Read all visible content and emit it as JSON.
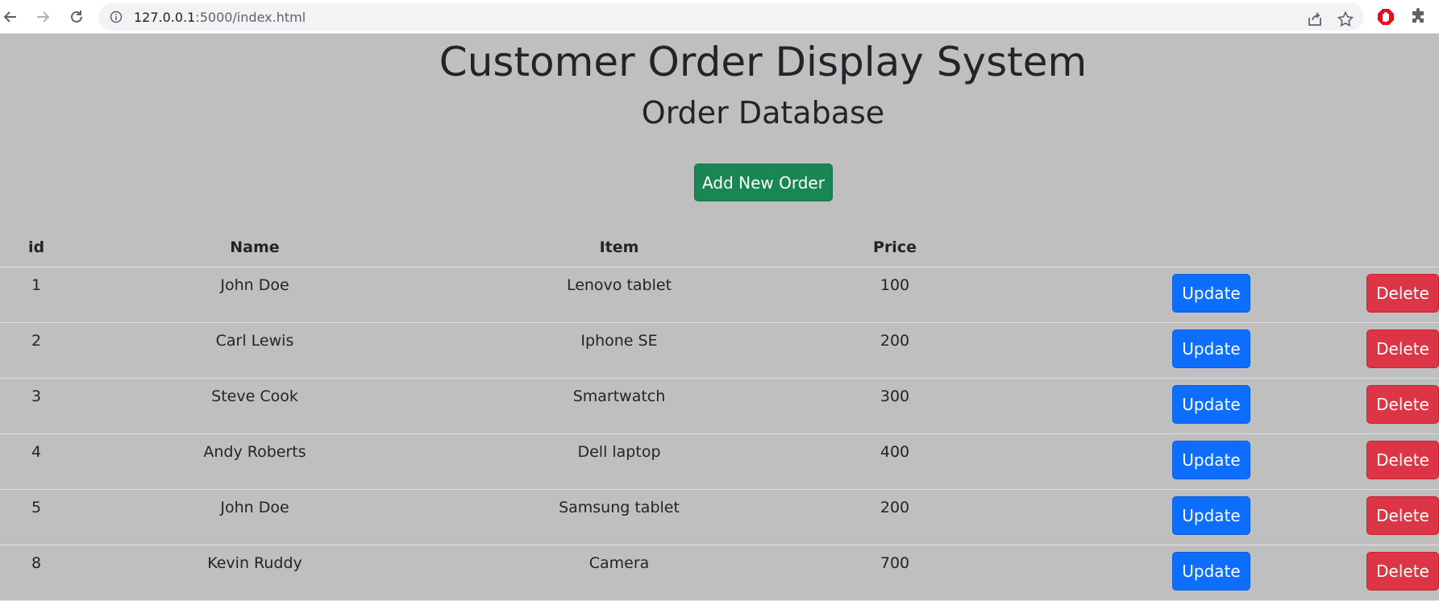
{
  "browser": {
    "url_host": "127.0.0.1",
    "url_rest": ":5000/index.html"
  },
  "page": {
    "title": "Customer Order Display System",
    "subtitle": "Order Database",
    "add_button_label": "Add New Order"
  },
  "table": {
    "headers": {
      "id": "id",
      "name": "Name",
      "item": "Item",
      "price": "Price"
    },
    "update_label": "Update",
    "delete_label": "Delete",
    "rows": [
      {
        "id": "1",
        "name": "John Doe",
        "item": "Lenovo tablet",
        "price": "100"
      },
      {
        "id": "2",
        "name": "Carl Lewis",
        "item": "Iphone SE",
        "price": "200"
      },
      {
        "id": "3",
        "name": "Steve Cook",
        "item": "Smartwatch",
        "price": "300"
      },
      {
        "id": "4",
        "name": "Andy Roberts",
        "item": "Dell laptop",
        "price": "400"
      },
      {
        "id": "5",
        "name": "John Doe",
        "item": "Samsung tablet",
        "price": "200"
      },
      {
        "id": "8",
        "name": "Kevin Ruddy",
        "item": "Camera",
        "price": "700"
      }
    ]
  },
  "colors": {
    "page_bg": "#bfbfbf",
    "add_button": "#198754",
    "update_button": "#0d6efd",
    "delete_button": "#dc3545"
  }
}
